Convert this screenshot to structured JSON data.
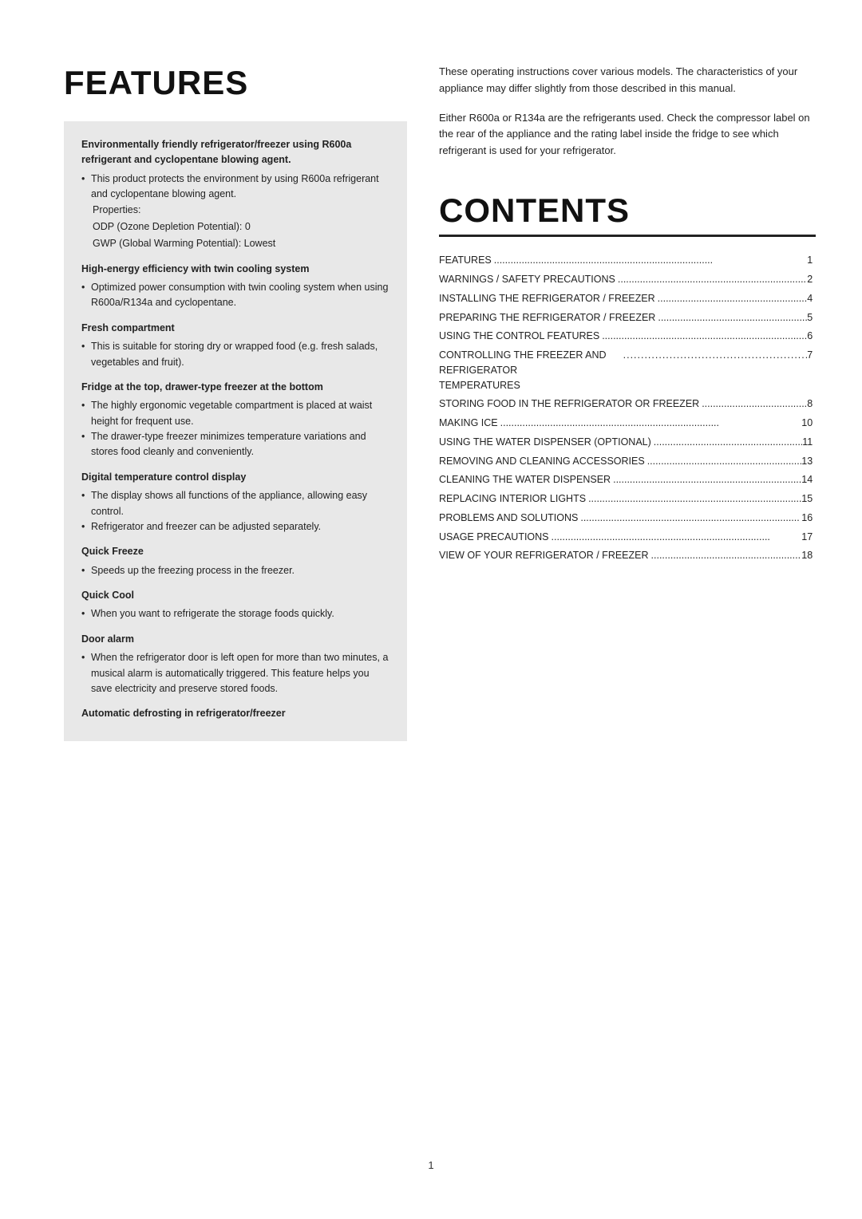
{
  "page": {
    "number": "1"
  },
  "features": {
    "title": "FEATURES",
    "box": {
      "bold_intro": "Environmentally friendly refrigerator/freezer using R600a refrigerant and cyclopentane blowing agent.",
      "bullet1": "This product protects the environment by using R600a refrigerant and cyclopentane blowing agent.",
      "properties_label": "Properties:",
      "odp": "ODP (Ozone Depletion Potential): 0",
      "gwp": "GWP (Global Warming Potential): Lowest",
      "section2_title": "High-energy efficiency with twin cooling system",
      "section2_bullet": "Optimized power consumption with twin cooling system when using R600a/R134a and cyclopentane.",
      "section3_title": "Fresh compartment",
      "section3_bullet": "This is suitable for storing dry or wrapped food (e.g. fresh salads, vegetables and fruit).",
      "section4_title": "Fridge at the top, drawer-type freezer at the bottom",
      "section4_bullet1": "The highly ergonomic vegetable compartment is placed at waist height for frequent use.",
      "section4_bullet2": "The drawer-type freezer minimizes temperature variations and stores food cleanly and conveniently.",
      "section5_title": "Digital temperature control display",
      "section5_bullet1": "The display shows all functions of the appliance, allowing easy control.",
      "section5_bullet2": "Refrigerator and freezer can be adjusted separately.",
      "section6_title": "Quick Freeze",
      "section6_bullet": "Speeds up the freezing process in the freezer.",
      "section7_title": "Quick Cool",
      "section7_bullet": "When you want to refrigerate the storage foods quickly.",
      "section8_title": "Door alarm",
      "section8_bullet": "When the refrigerator door is left open for more than two minutes, a musical alarm is automatically triggered. This feature helps you save electricity and preserve stored foods.",
      "section9_title": "Automatic defrosting in refrigerator/freezer"
    }
  },
  "right_column": {
    "para1": "These operating instructions cover various models. The characteristics of your appliance may differ slightly from those described in this manual.",
    "para2": "Either R600a or R134a are the refrigerants used. Check the compressor label on the rear of the appliance and the rating label inside the fridge to see which refrigerant is used for your refrigerator."
  },
  "contents": {
    "title": "CONTENTS",
    "items": [
      {
        "label": "FEATURES",
        "dots": true,
        "page": "1"
      },
      {
        "label": "WARNINGS / SAFETY PRECAUTIONS",
        "dots": true,
        "page": "2"
      },
      {
        "label": "INSTALLING THE REFRIGERATOR / FREEZER",
        "dots": true,
        "page": "4"
      },
      {
        "label": "PREPARING THE REFRIGERATOR / FREEZER",
        "dots": true,
        "page": "5"
      },
      {
        "label": "USING THE CONTROL FEATURES",
        "dots": true,
        "page": "6"
      },
      {
        "label": "CONTROLLING THE FREEZER AND REFRIGERATOR\nTEMPERATURES",
        "dots": true,
        "page": "7"
      },
      {
        "label": "STORING FOOD IN THE REFRIGERATOR OR FREEZER",
        "dots": true,
        "page": "8"
      },
      {
        "label": "MAKING ICE",
        "dots": true,
        "page": "10"
      },
      {
        "label": "USING THE WATER DISPENSER (OPTIONAL)",
        "dots": true,
        "page": "11"
      },
      {
        "label": "REMOVING AND CLEANING ACCESSORIES",
        "dots": true,
        "page": "13"
      },
      {
        "label": "CLEANING THE WATER DISPENSER",
        "dots": true,
        "page": "14"
      },
      {
        "label": "REPLACING INTERIOR LIGHTS",
        "dots": true,
        "page": "15"
      },
      {
        "label": "PROBLEMS AND SOLUTIONS",
        "dots": true,
        "page": "16"
      },
      {
        "label": "USAGE PRECAUTIONS",
        "dots": true,
        "page": "17"
      },
      {
        "label": "VIEW OF YOUR REFRIGERATOR / FREEZER",
        "dots": true,
        "page": "18"
      }
    ]
  }
}
